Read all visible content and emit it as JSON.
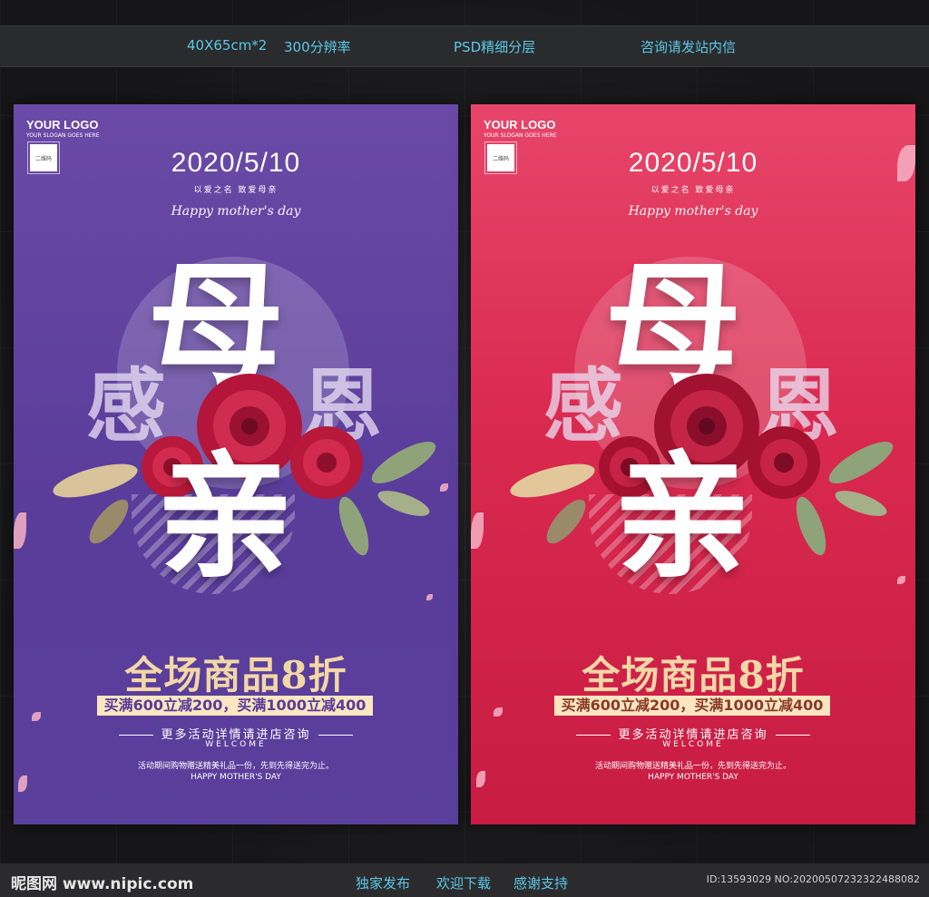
{
  "topbar": {
    "size": "40X65cm*2",
    "resolution": "300分辨率",
    "layers": "PSD精细分层",
    "contact": "咨询请发站内信"
  },
  "poster": {
    "logo": "YOUR LOGO",
    "slogan": "YOUR SLOGAN GOES HERE",
    "qr_label": "二维码",
    "date": "2020/5/10",
    "subtitle": "以爱之名 致爱母亲",
    "script": "Happy mother's day",
    "char_mu": "母",
    "char_qin": "亲",
    "char_gan": "感",
    "char_en": "恩",
    "promo": "全场商品8折",
    "deal": "买满600立减200，买满1000立减400",
    "more": "更多活动详情请进店咨询",
    "welcome": "WELCOME",
    "note": "活动期间购物赠送精美礼品一份，先到先得送完为止。",
    "happy": "HAPPY MOTHER'S DAY"
  },
  "colors": {
    "purple": "#5f419e",
    "red": "#d9294f",
    "gold": "#f2d7a7",
    "accent": "#5bc8e8"
  },
  "bottombar": {
    "site_logo": "昵图网 www.nipic.com",
    "link1": "独家发布",
    "link2": "欢迎下载",
    "link3": "感谢支持",
    "id": "ID:13593029 NO:20200507232322488082"
  }
}
